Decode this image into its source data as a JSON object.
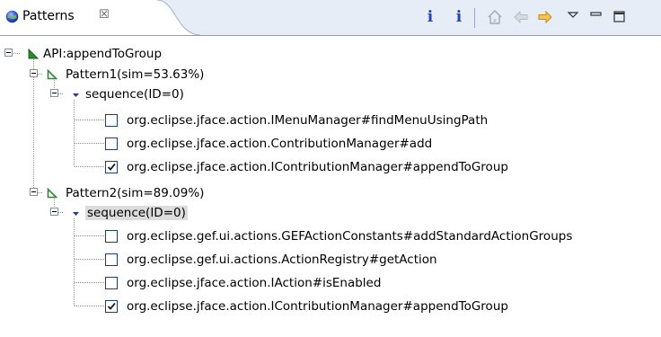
{
  "view": {
    "tab_label": "Patterns",
    "tab_close_glyph": "☒",
    "toolbar": [
      {
        "icon": "info-icon",
        "glyph": "i"
      },
      {
        "icon": "info-icon",
        "glyph": "i"
      },
      {
        "icon": "home-icon"
      },
      {
        "icon": "back-arrow-icon"
      },
      {
        "icon": "forward-arrow-icon"
      },
      {
        "icon": "view-menu-icon"
      },
      {
        "icon": "minimize-icon"
      },
      {
        "icon": "maximize-icon"
      }
    ]
  },
  "tree": {
    "root": {
      "label": "API:appendToGroup",
      "expanded": true,
      "icon": "api-icon"
    },
    "patterns": [
      {
        "label": "Pattern1(sim=53.63%)",
        "icon": "pattern-icon",
        "sequence": {
          "label": "sequence(ID=0)",
          "selected": false,
          "items": [
            {
              "label": "org.eclipse.jface.action.IMenuManager#findMenuUsingPath",
              "checked": false
            },
            {
              "label": "org.eclipse.jface.action.ContributionManager#add",
              "checked": false
            },
            {
              "label": "org.eclipse.jface.action.IContributionManager#appendToGroup",
              "checked": true
            }
          ]
        }
      },
      {
        "label": "Pattern2(sim=89.09%)",
        "icon": "pattern-icon",
        "sequence": {
          "label": "sequence(ID=0)",
          "selected": true,
          "items": [
            {
              "label": "org.eclipse.gef.ui.actions.GEFActionConstants#addStandardActionGroups",
              "checked": false
            },
            {
              "label": "org.eclipse.gef.ui.actions.ActionRegistry#getAction",
              "checked": false
            },
            {
              "label": "org.eclipse.jface.action.IAction#isEnabled",
              "checked": false
            },
            {
              "label": "org.eclipse.jface.action.IContributionManager#appendToGroup",
              "checked": true
            }
          ]
        }
      }
    ]
  }
}
